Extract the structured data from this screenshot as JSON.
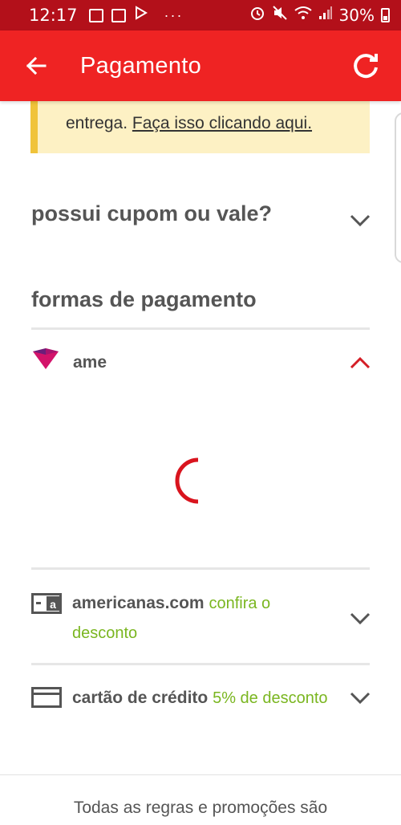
{
  "status_bar": {
    "time": "12:17",
    "more": "···",
    "battery": "30%"
  },
  "app_bar": {
    "title": "Pagamento",
    "back_icon": "arrow-left-icon",
    "refresh_icon": "refresh-icon",
    "color": "#ef2323"
  },
  "notice": {
    "text": "entrega.",
    "link": "Faça isso clicando aqui.",
    "background": "#fdf1c4",
    "accent": "#f0c33a"
  },
  "coupon": {
    "label": "possui cupom ou vale?"
  },
  "payment": {
    "title": "formas de pagamento",
    "methods": [
      {
        "label": "ame",
        "expanded": true,
        "icon": "ame-heart-logo"
      },
      {
        "label": "americanas.com",
        "promo": "confira o",
        "promo_line2": "desconto",
        "icon": "americanas-card-icon"
      },
      {
        "label": "cartão de crédito",
        "promo": "5% de desconto",
        "icon": "credit-card-icon"
      }
    ],
    "promo_color": "#7ab620"
  },
  "footer": {
    "text": "Todas as regras e promoções são"
  }
}
